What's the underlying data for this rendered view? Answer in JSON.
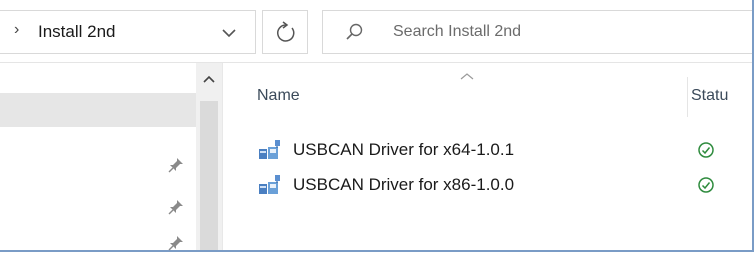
{
  "address_bar": {
    "path": "Install 2nd",
    "separator_icon": "chevron-right-icon",
    "dropdown_icon": "chevron-down-icon"
  },
  "refresh_icon": "refresh-icon",
  "search": {
    "placeholder": "Search Install 2nd",
    "icon": "search-icon"
  },
  "columns": {
    "name": "Name",
    "status": "Statu"
  },
  "files": [
    {
      "name": "USBCAN Driver for x64-1.0.1",
      "icon": "installer-icon",
      "status_icon": "sync-ok-icon"
    },
    {
      "name": "USBCAN Driver for x86-1.0.0",
      "icon": "installer-icon",
      "status_icon": "sync-ok-icon"
    }
  ],
  "nav_pins": 3,
  "colors": {
    "frame_border": "#7a9cc6",
    "status_ok": "#2e8b3d",
    "selected_row": "#e6e6e6"
  }
}
